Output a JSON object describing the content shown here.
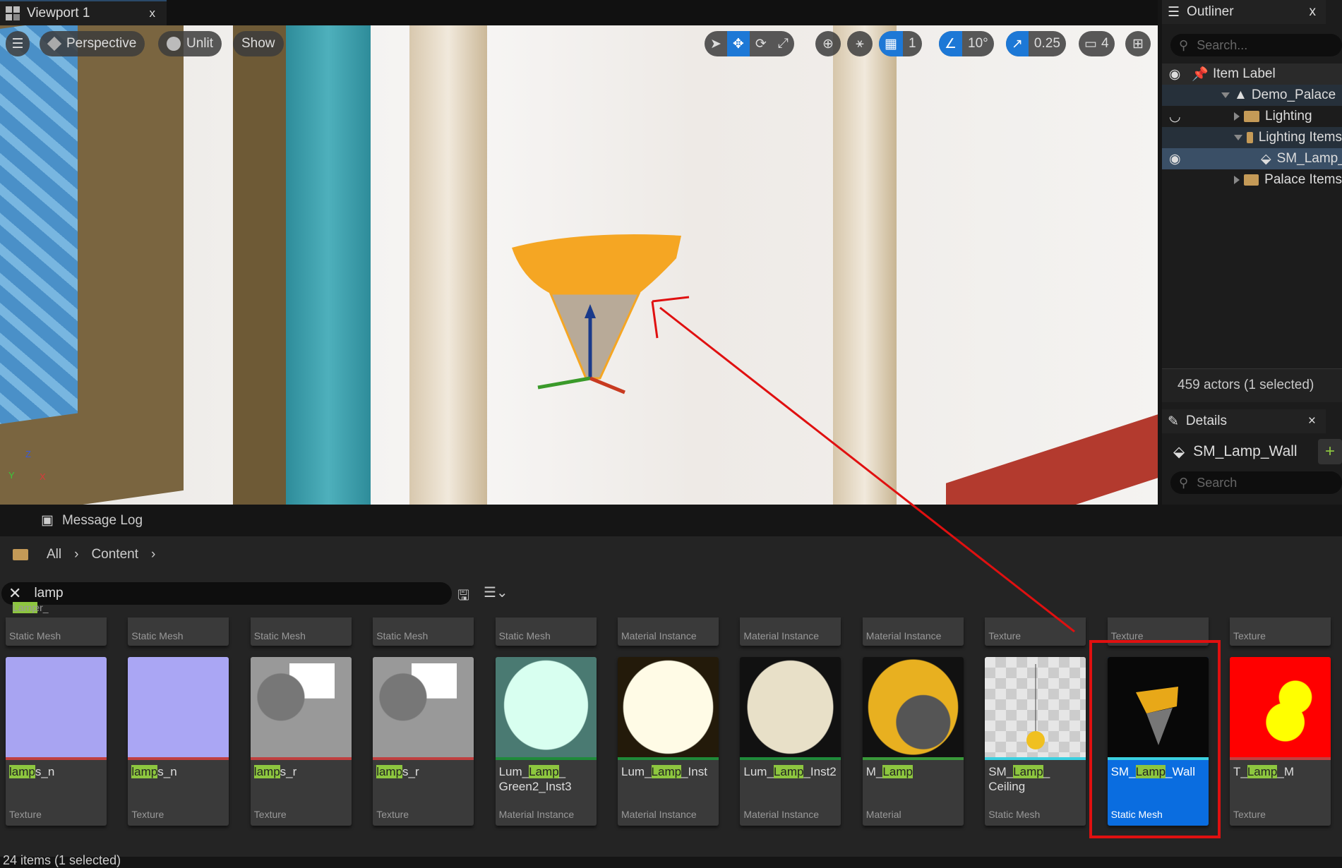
{
  "viewport_tab": {
    "title": "Viewport 1",
    "close": "x"
  },
  "viewport_toolbar": {
    "menu": "☰",
    "perspective": "Perspective",
    "lighting": "Unlit",
    "show": "Show",
    "grid_snap": "1",
    "rotation_snap": "10°",
    "scale_snap": "0.25",
    "camera_speed": "4"
  },
  "axis_labels": {
    "z": "Z",
    "y": "Y",
    "x": "X"
  },
  "outliner": {
    "title": "Outliner",
    "close": "x",
    "search_placeholder": "Search...",
    "column": "Item Label",
    "rows": [
      {
        "label": "Demo_Palace"
      },
      {
        "label": "Lighting"
      },
      {
        "label": "Lighting Items"
      },
      {
        "label": "SM_Lamp_Wall"
      },
      {
        "label": "Palace Items"
      }
    ],
    "status": "459 actors (1 selected)"
  },
  "details": {
    "title": "Details",
    "close": "×",
    "object": "SM_Lamp_Wall",
    "add": "+",
    "search_placeholder": "Search"
  },
  "bottom": {
    "tab": "Message Log",
    "breadcrumb": [
      "All",
      "Content"
    ],
    "search_value": "lamp",
    "footer": "24 items (1 selected)"
  },
  "top_row": [
    {
      "pre": "Corner_",
      "match": "Lamp",
      "post": "",
      "type": "Static Mesh"
    },
    {
      "type": "Static Mesh"
    },
    {
      "type": "Static Mesh"
    },
    {
      "type": "Static Mesh"
    },
    {
      "type": "Static Mesh"
    },
    {
      "type": "Material Instance"
    },
    {
      "type": "Material Instance"
    },
    {
      "type": "Material Instance"
    },
    {
      "type": "Texture"
    },
    {
      "type": "Texture"
    },
    {
      "type": "Texture"
    }
  ],
  "assets": [
    {
      "pre": "",
      "match": "lamp",
      "post": "s_n",
      "type": "Texture",
      "stripe": "#c04040",
      "thumb": "normal"
    },
    {
      "pre": "",
      "match": "lamp",
      "post": "s_n",
      "type": "Texture",
      "stripe": "#c04040",
      "thumb": "normal2"
    },
    {
      "pre": "",
      "match": "lamp",
      "post": "s_r",
      "type": "Texture",
      "stripe": "#c04040",
      "thumb": "rough"
    },
    {
      "pre": "",
      "match": "lamp",
      "post": "s_r",
      "type": "Texture",
      "stripe": "#c04040",
      "thumb": "rough"
    },
    {
      "pre": "Lum_",
      "match": "Lamp",
      "post": "_ Green2_Inst3",
      "type": "Material Instance",
      "stripe": "#1f8a3a",
      "thumb": "green"
    },
    {
      "pre": "Lum_",
      "match": "Lamp",
      "post": "_Inst",
      "type": "Material Instance",
      "stripe": "#1f8a3a",
      "thumb": "warm"
    },
    {
      "pre": "Lum_",
      "match": "Lamp",
      "post": "_Inst2",
      "type": "Material Instance",
      "stripe": "#1f8a3a",
      "thumb": "mesh"
    },
    {
      "pre": "M_",
      "match": "Lamp",
      "post": "",
      "type": "Material",
      "stripe": "#3a9a3a",
      "thumb": "yellow"
    },
    {
      "pre": "SM_",
      "match": "Lamp",
      "post": "_ Ceiling",
      "type": "Static Mesh",
      "stripe": "#3ad0e0",
      "thumb": "ceiling"
    },
    {
      "pre": "SM_",
      "match": "Lamp",
      "post": "_Wall",
      "type": "Static Mesh",
      "stripe": "#3ad0e0",
      "thumb": "wall",
      "selected": true
    },
    {
      "pre": "T_",
      "match": "Lamp",
      "post": "_M",
      "type": "Texture",
      "stripe": "#c04040",
      "thumb": "red"
    }
  ],
  "colors": {
    "accent": "#1d78d6",
    "highlight": "#8dc63f",
    "annotation": "#e01010"
  }
}
